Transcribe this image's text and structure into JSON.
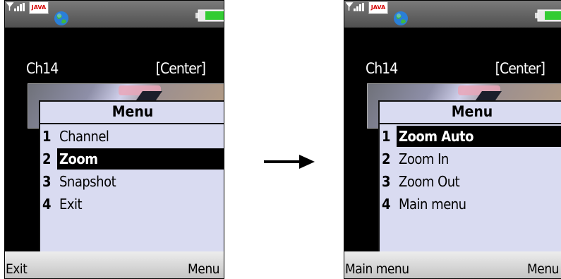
{
  "colors": {
    "menu_background": "#d9dbf1",
    "selection_background": "#000000",
    "status_bar": "#6a6a6a",
    "softkey_bar": "#d8d8d8",
    "java_text": "#d40000",
    "battery_fill": "#33cc33"
  },
  "icons": [
    "signal-icon",
    "java-icon",
    "globe-icon",
    "battery-icon",
    "arrow-right-icon"
  ],
  "left_screen": {
    "status": {
      "java_label": "JAVA"
    },
    "channel": "Ch14",
    "position": "[Center]",
    "menu": {
      "title": "Menu",
      "items": [
        {
          "number": "1",
          "label": "Channel",
          "selected": false
        },
        {
          "number": "2",
          "label": "Zoom",
          "selected": true
        },
        {
          "number": "3",
          "label": "Snapshot",
          "selected": false
        },
        {
          "number": "4",
          "label": "Exit",
          "selected": false
        }
      ]
    },
    "softkeys": {
      "left": "Exit",
      "right": "Menu"
    }
  },
  "right_screen": {
    "status": {
      "java_label": "JAVA"
    },
    "channel": "Ch14",
    "position": "[Center]",
    "menu": {
      "title": "Menu",
      "items": [
        {
          "number": "1",
          "label": "Zoom Auto",
          "selected": true
        },
        {
          "number": "2",
          "label": "Zoom In",
          "selected": false
        },
        {
          "number": "3",
          "label": "Zoom Out",
          "selected": false
        },
        {
          "number": "4",
          "label": "Main menu",
          "selected": false
        }
      ]
    },
    "softkeys": {
      "left": "Main menu",
      "right": "Menu"
    }
  }
}
